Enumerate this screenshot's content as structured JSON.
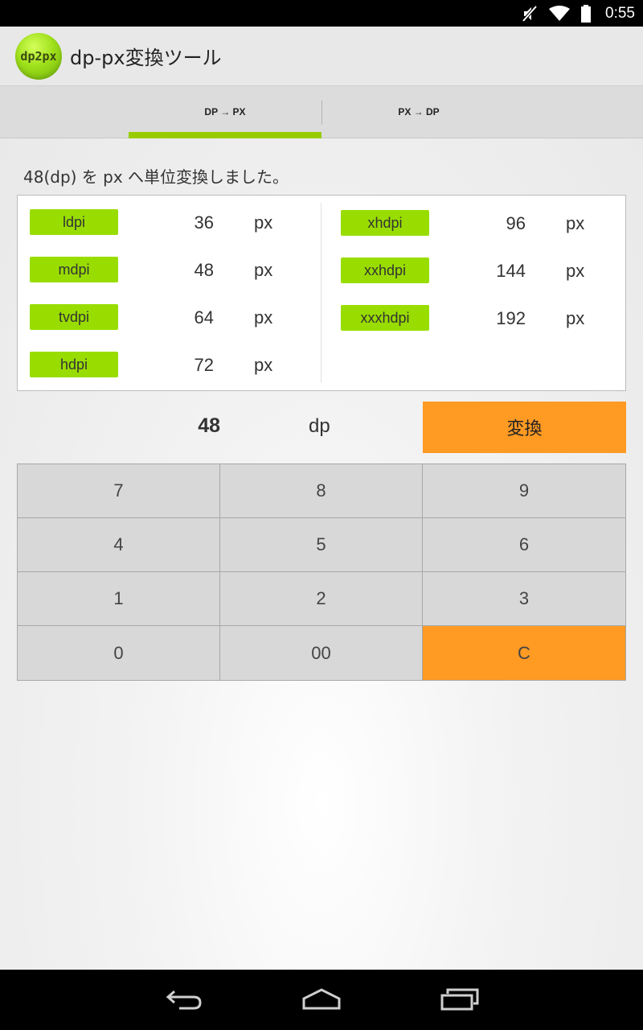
{
  "status_bar": {
    "time": "0:55",
    "icons": [
      "mute-icon",
      "wifi-icon",
      "battery-icon"
    ]
  },
  "app": {
    "logo_text": "dp2px",
    "title": "dp-px変換ツール"
  },
  "tabs": [
    {
      "label": "DP → PX",
      "selected": true
    },
    {
      "label": "PX → DP",
      "selected": false
    }
  ],
  "message": "48(dp) を px へ単位変換しました。",
  "results": {
    "left": [
      {
        "dpi": "ldpi",
        "value": "36",
        "unit": "px"
      },
      {
        "dpi": "mdpi",
        "value": "48",
        "unit": "px"
      },
      {
        "dpi": "tvdpi",
        "value": "64",
        "unit": "px"
      },
      {
        "dpi": "hdpi",
        "value": "72",
        "unit": "px"
      }
    ],
    "right": [
      {
        "dpi": "xhdpi",
        "value": "96",
        "unit": "px"
      },
      {
        "dpi": "xxhdpi",
        "value": "144",
        "unit": "px"
      },
      {
        "dpi": "xxxhdpi",
        "value": "192",
        "unit": "px"
      }
    ]
  },
  "input": {
    "value": "48",
    "unit": "dp",
    "convert_label": "変換"
  },
  "keypad": {
    "rows": [
      [
        "7",
        "8",
        "9"
      ],
      [
        "4",
        "5",
        "6"
      ],
      [
        "1",
        "2",
        "3"
      ],
      [
        "0",
        "00",
        "C"
      ]
    ]
  },
  "colors": {
    "accent_green": "#99cc00",
    "badge_green": "#99dd00",
    "orange": "#ff9a23"
  },
  "nav_bar": {
    "icons": [
      "back-icon",
      "home-icon",
      "recents-icon"
    ]
  }
}
